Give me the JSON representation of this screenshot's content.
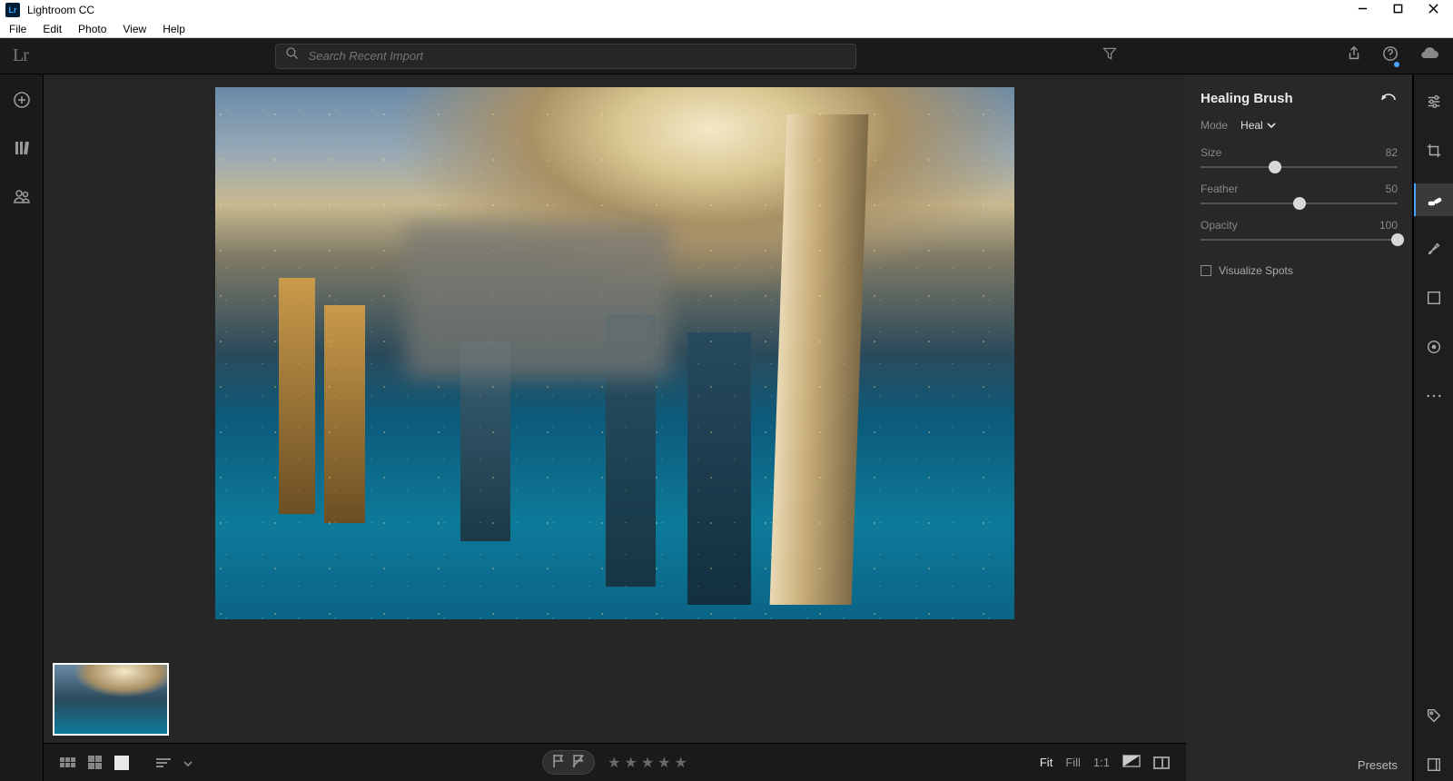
{
  "window": {
    "app_title": "Lightroom CC",
    "logo_text": "Lr"
  },
  "menu": {
    "items": [
      "File",
      "Edit",
      "Photo",
      "View",
      "Help"
    ]
  },
  "app_header": {
    "logo": "Lr",
    "search_placeholder": "Search Recent Import"
  },
  "healing_panel": {
    "title": "Healing Brush",
    "mode_label": "Mode",
    "mode_value": "Heal",
    "sliders": {
      "size": {
        "label": "Size",
        "value": 82,
        "min": 0,
        "max": 100,
        "pos": 38
      },
      "feather": {
        "label": "Feather",
        "value": 50,
        "min": 0,
        "max": 100,
        "pos": 50
      },
      "opacity": {
        "label": "Opacity",
        "value": 100,
        "min": 0,
        "max": 100,
        "pos": 100
      }
    },
    "visualize_label": "Visualize Spots",
    "visualize_checked": false
  },
  "bottom_bar": {
    "zoom": {
      "fit": "Fit",
      "fill": "Fill",
      "one_to_one": "1:1"
    },
    "presets_label": "Presets"
  },
  "left_rail": {
    "add": "add-photo",
    "library": "library",
    "people": "people"
  },
  "right_rail_tools": [
    {
      "name": "adjust-sliders",
      "active": false
    },
    {
      "name": "crop-tool",
      "active": false
    },
    {
      "name": "healing-brush",
      "active": true
    },
    {
      "name": "brush-tool",
      "active": false
    },
    {
      "name": "linear-gradient",
      "active": false
    },
    {
      "name": "radial-gradient",
      "active": false
    },
    {
      "name": "more-menu",
      "active": false
    }
  ]
}
